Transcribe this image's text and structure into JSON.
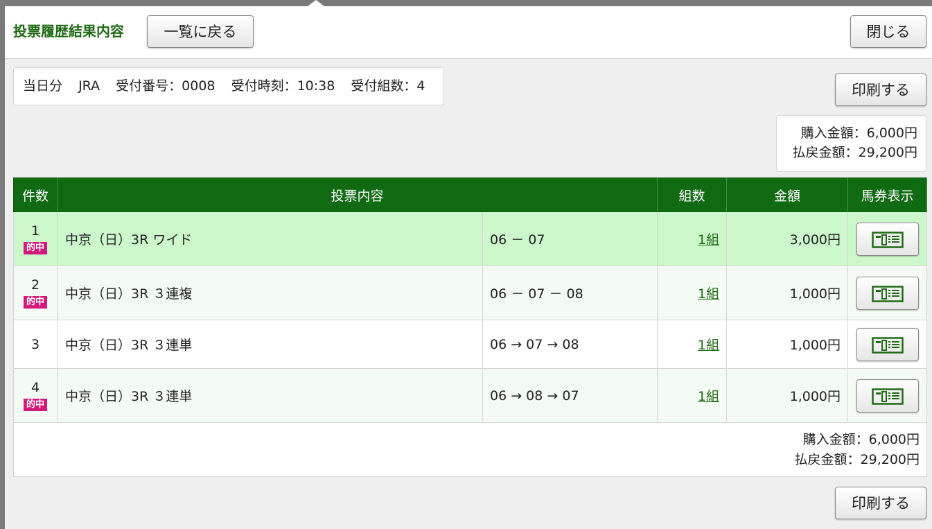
{
  "header": {
    "title": "投票履歴結果内容",
    "back_label": "一覧に戻る",
    "close_label": "閉じる"
  },
  "info": {
    "day": "当日分",
    "org": "JRA",
    "receipt_no": "受付番号：0008",
    "receipt_time": "受付時刻：10:38",
    "receipt_count": "受付組数：4"
  },
  "print_label": "印刷する",
  "summary": {
    "purchase": "購入金額：6,000円",
    "payout": "払戻金額：29,200円"
  },
  "table": {
    "headers": [
      "件数",
      "投票内容",
      "組数",
      "金額",
      "馬券表示"
    ],
    "hit_label": "的中",
    "rows": [
      {
        "no": "1",
        "hit": true,
        "race": "中京（日）3R ワイド",
        "combo": "06 － 07",
        "kumi": "1組",
        "amount": "3,000円"
      },
      {
        "no": "2",
        "hit": true,
        "race": "中京（日）3R ３連複",
        "combo": "06 － 07 － 08",
        "kumi": "1組",
        "amount": "1,000円"
      },
      {
        "no": "3",
        "hit": false,
        "race": "中京（日）3R ３連単",
        "combo": "06 → 07 → 08",
        "kumi": "1組",
        "amount": "1,000円"
      },
      {
        "no": "4",
        "hit": true,
        "race": "中京（日）3R ３連単",
        "combo": "06 → 08 → 07",
        "kumi": "1組",
        "amount": "1,000円"
      }
    ],
    "ticket_icon": "ticket-icon"
  },
  "colors": {
    "brand_green": "#0f6a12",
    "hit_row": "#ccf8cc",
    "hit_badge": "#d4197a"
  }
}
